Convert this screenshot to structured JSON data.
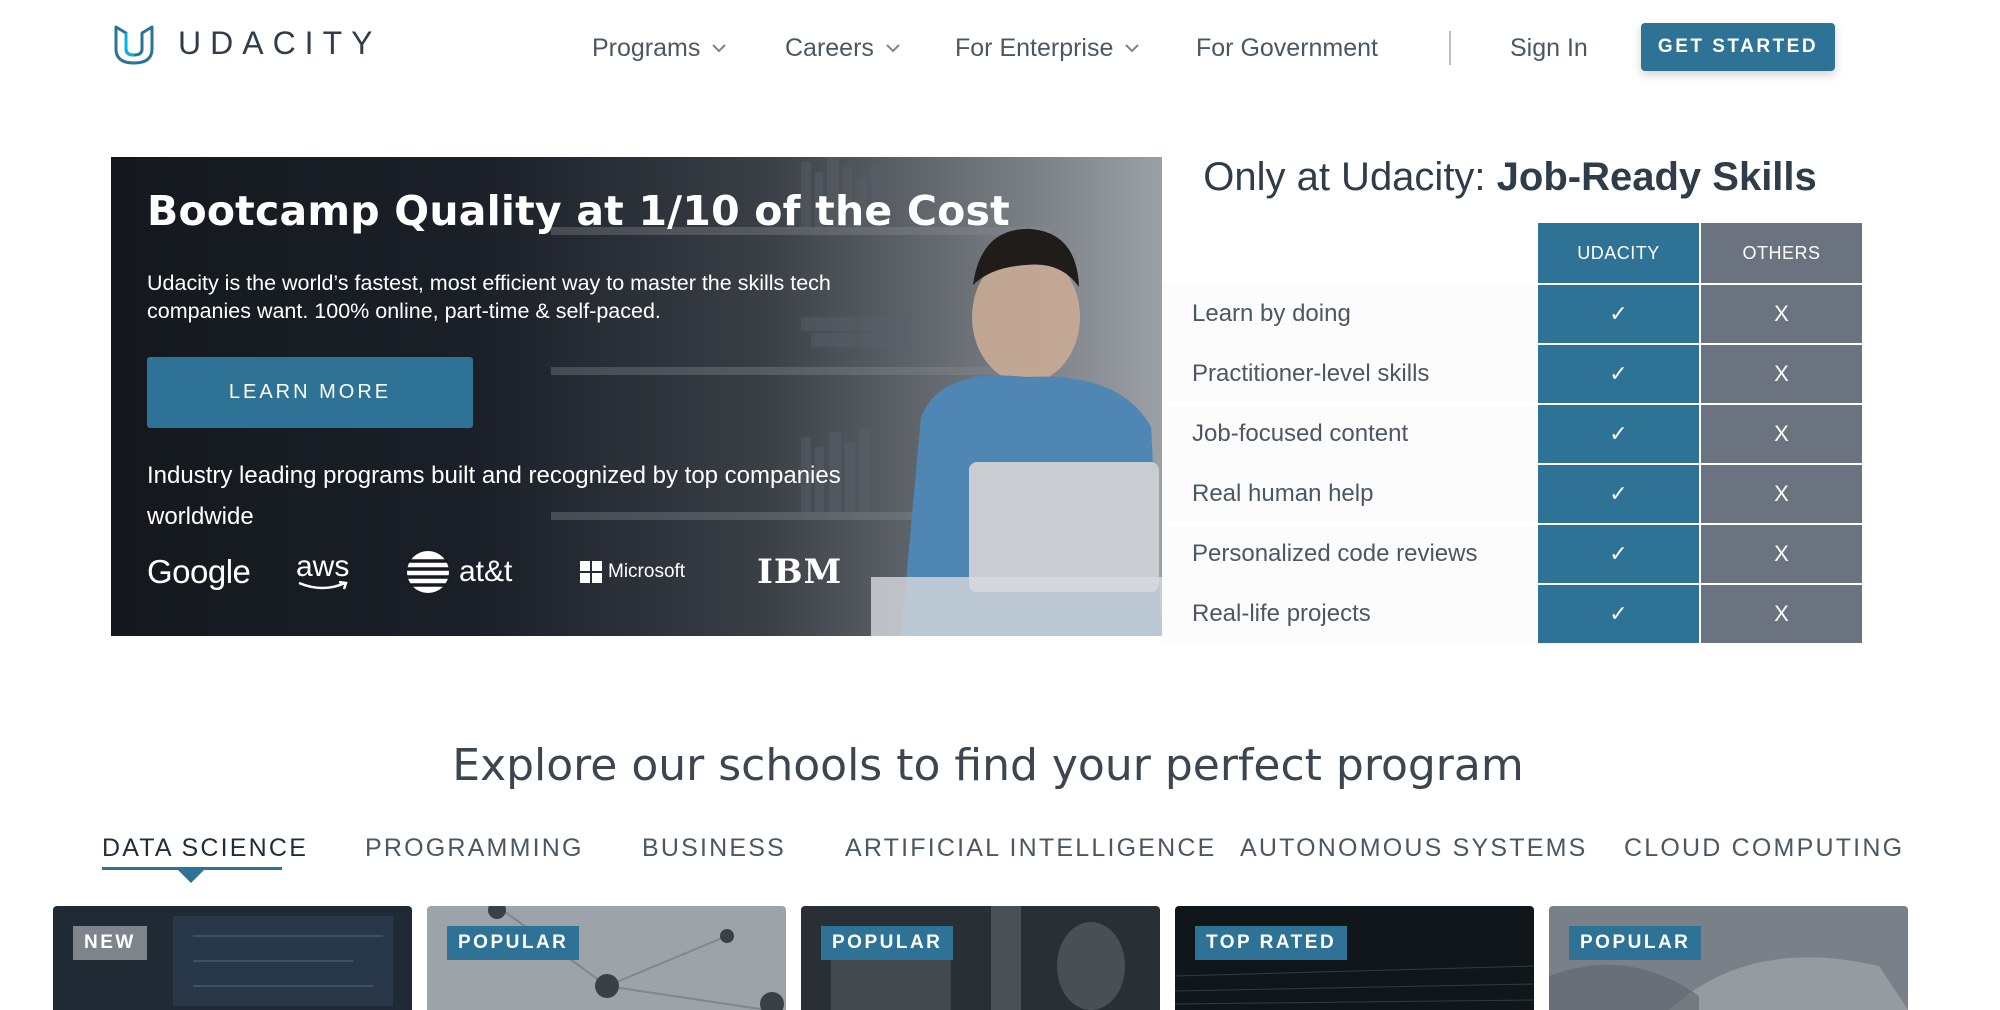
{
  "header": {
    "brand": "UDACITY",
    "nav": [
      {
        "label": "Programs",
        "has_dropdown": true
      },
      {
        "label": "Careers",
        "has_dropdown": true
      },
      {
        "label": "For Enterprise",
        "has_dropdown": true
      },
      {
        "label": "For Government",
        "has_dropdown": false
      }
    ],
    "sign_in": "Sign In",
    "get_started": "GET STARTED"
  },
  "hero": {
    "title": "Bootcamp Quality at 1/10 of the Cost",
    "subtitle": "Udacity is the world’s fastest, most efficient way to master the skills tech companies want. 100% online, part-time & self-paced.",
    "cta": "LEARN MORE",
    "industry_text": "Industry leading programs built and recognized by top companies worldwide",
    "partner_logos": [
      "Google",
      "aws",
      "at&t",
      "Microsoft",
      "IBM"
    ]
  },
  "comparison": {
    "title_light": "Only at Udacity: ",
    "title_bold": "Job-Ready Skills",
    "col_udacity": "UDACITY",
    "col_others": "OTHERS",
    "yes_mark": "✓",
    "no_mark": "X",
    "rows": [
      "Learn by doing",
      "Practitioner-level skills",
      "Job-focused content",
      "Real human help",
      "Personalized code reviews",
      "Real-life projects"
    ]
  },
  "schools": {
    "title": "Explore our schools to find your perfect program",
    "tabs": [
      "DATA SCIENCE",
      "PROGRAMMING",
      "BUSINESS",
      "ARTIFICIAL INTELLIGENCE",
      "AUTONOMOUS SYSTEMS",
      "CLOUD COMPUTING"
    ],
    "active_tab": "DATA SCIENCE",
    "cards": [
      {
        "badge": "NEW"
      },
      {
        "badge": "POPULAR"
      },
      {
        "badge": "POPULAR"
      },
      {
        "badge": "TOP RATED"
      },
      {
        "badge": "POPULAR"
      }
    ]
  },
  "colors": {
    "brand_blue": "#2e7396",
    "others_grey": "#6b7280",
    "text_dark": "#2e3d49"
  }
}
